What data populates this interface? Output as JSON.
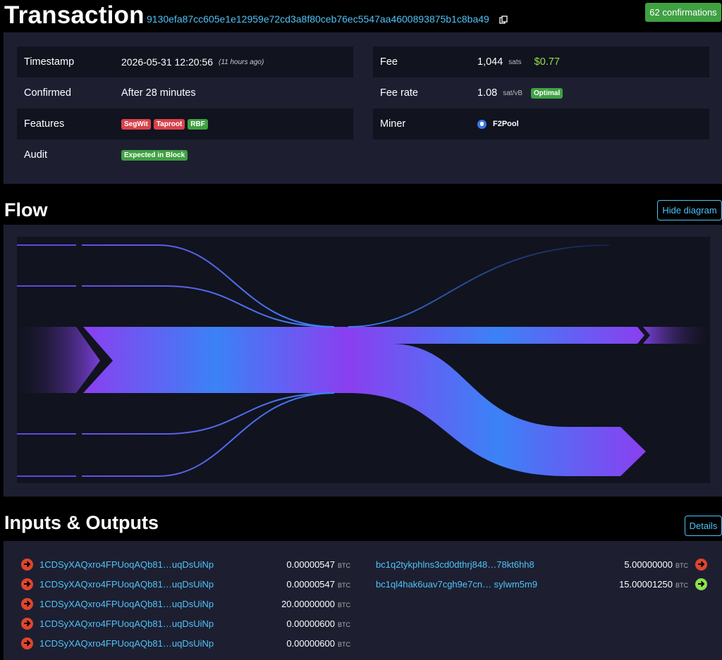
{
  "header": {
    "title": "Transaction",
    "txid": "9130efa87cc605e1e12959e72cd3a8f80ceb76ec5547aa4600893875b1c8ba49",
    "confirmations": "62 confirmations"
  },
  "details": {
    "timestamp_label": "Timestamp",
    "timestamp_value": "2026-05-31 12:20:56",
    "timestamp_ago": "(11 hours ago)",
    "confirmed_label": "Confirmed",
    "confirmed_value": "After 28 minutes",
    "features_label": "Features",
    "features": [
      "SegWit",
      "Taproot",
      "RBF"
    ],
    "audit_label": "Audit",
    "audit_value": "Expected in Block",
    "fee_label": "Fee",
    "fee_value": "1,044",
    "fee_unit": "sats",
    "fee_usd": "$0.77",
    "feerate_label": "Fee rate",
    "feerate_value": "1.08",
    "feerate_unit": "sat/vB",
    "feerate_badge": "Optimal",
    "miner_label": "Miner",
    "miner_value": "F2Pool"
  },
  "flow": {
    "title": "Flow",
    "hide_button": "Hide diagram"
  },
  "io": {
    "title": "Inputs & Outputs",
    "details_button": "Details",
    "unit": "BTC",
    "inputs": [
      {
        "address": "1CDSyXAQxro4FPUoqAQb81…uqDsUiNp",
        "amount": "0.00000547"
      },
      {
        "address": "1CDSyXAQxro4FPUoqAQb81…uqDsUiNp",
        "amount": "0.00000547"
      },
      {
        "address": "1CDSyXAQxro4FPUoqAQb81…uqDsUiNp",
        "amount": "20.00000000"
      },
      {
        "address": "1CDSyXAQxro4FPUoqAQb81…uqDsUiNp",
        "amount": "0.00000600"
      },
      {
        "address": "1CDSyXAQxro4FPUoqAQb81…uqDsUiNp",
        "amount": "0.00000600"
      }
    ],
    "outputs": [
      {
        "address": "bc1q2tykphlns3cd0dthrj848…78kt6hh8",
        "amount": "5.00000000",
        "status": "spent"
      },
      {
        "address": "bc1ql4hak6uav7cgh9e7cn… sylwm5m9",
        "amount": "15.00001250",
        "status": "unspent"
      }
    ]
  },
  "colors": {
    "link": "#4fc3f7",
    "badge_green": "#3fa142",
    "tag_red": "#d8424b",
    "usd_green": "#8ee04c",
    "spent_red": "#e0452e",
    "flow_purple": "#8a3ff0",
    "flow_blue": "#3b82f6"
  }
}
